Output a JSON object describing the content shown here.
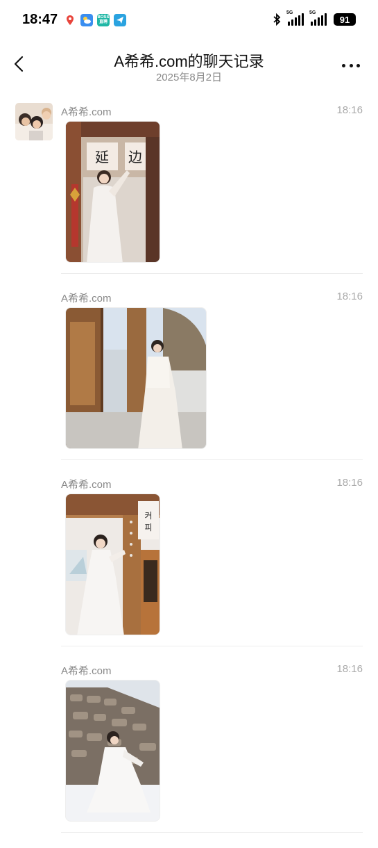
{
  "status": {
    "time": "18:47",
    "network1": "5G",
    "network2": "5G",
    "battery": "91",
    "app_icons": [
      "map-pin-icon",
      "weather-icon",
      "boss-icon",
      "telegram-icon"
    ],
    "boss_label": "BOSS\n直聘"
  },
  "header": {
    "title": "A希希.com的聊天记录",
    "subtitle": "2025年8月2日"
  },
  "messages": [
    {
      "sender": "A希希.com",
      "time": "18:16",
      "photo": "hanbok-photo-doorway-sign"
    },
    {
      "sender": "A希希.com",
      "time": "18:16",
      "photo": "hanbok-photo-wooden-door"
    },
    {
      "sender": "A希希.com",
      "time": "18:16",
      "photo": "hanbok-photo-pillar"
    },
    {
      "sender": "A希希.com",
      "time": "18:16",
      "photo": "hanbok-photo-stone-wall-snow"
    }
  ],
  "colors": {
    "text_primary": "#111111",
    "text_secondary": "#888888",
    "divider": "#ececec"
  }
}
